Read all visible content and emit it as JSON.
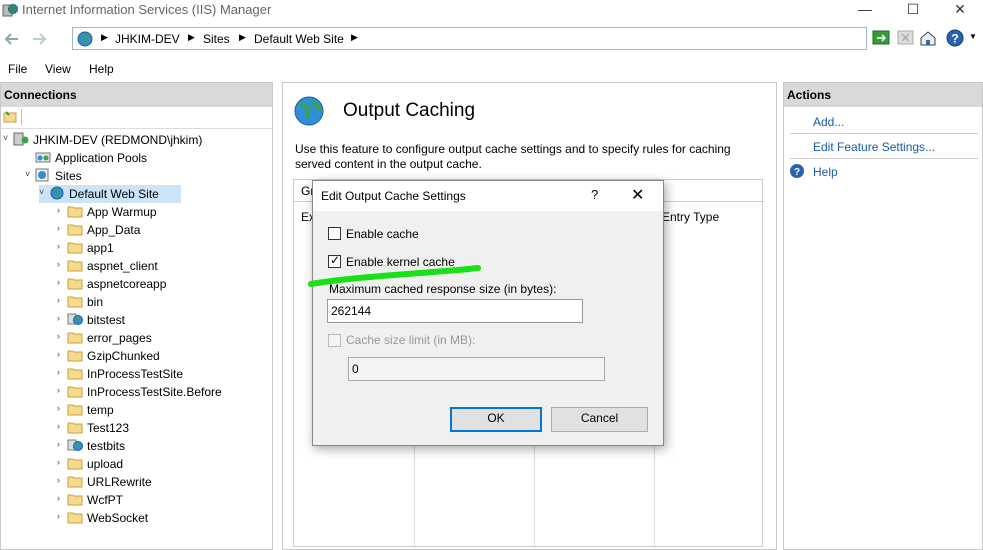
{
  "window": {
    "title": "Internet Information Services (IIS) Manager",
    "controls": {
      "minimize": "—",
      "maximize": "☐",
      "close": "✕"
    }
  },
  "address": {
    "crumbs": [
      "JHKIM-DEV",
      "Sites",
      "Default Web Site"
    ],
    "separator": "▶"
  },
  "menu": [
    "File",
    "View",
    "Help"
  ],
  "connections": {
    "header": "Connections",
    "tree": [
      {
        "label": "JHKIM-DEV (REDMOND\\jhkim)",
        "icon": "server-icon",
        "level": 0,
        "expander": "˅"
      },
      {
        "label": "Application Pools",
        "icon": "app-pools-icon",
        "level": 1,
        "expander": ""
      },
      {
        "label": "Sites",
        "icon": "sites-icon",
        "level": 1,
        "expander": "˅"
      },
      {
        "label": "Default Web Site",
        "icon": "globe-icon",
        "level": 2,
        "expander": "˅",
        "selected": true
      },
      {
        "label": "App Warmup",
        "icon": "folder-icon",
        "level": 3,
        "expander": "›"
      },
      {
        "label": "App_Data",
        "icon": "folder-icon",
        "level": 3,
        "expander": "›"
      },
      {
        "label": "app1",
        "icon": "folder-icon",
        "level": 3,
        "expander": "›"
      },
      {
        "label": "aspnet_client",
        "icon": "folder-icon",
        "level": 3,
        "expander": "›"
      },
      {
        "label": "aspnetcoreapp",
        "icon": "folder-icon",
        "level": 3,
        "expander": "›"
      },
      {
        "label": "bin",
        "icon": "folder-icon",
        "level": 3,
        "expander": "›"
      },
      {
        "label": "bitstest",
        "icon": "web-app-icon",
        "level": 3,
        "expander": "›"
      },
      {
        "label": "error_pages",
        "icon": "folder-icon",
        "level": 3,
        "expander": "›"
      },
      {
        "label": "GzipChunked",
        "icon": "folder-icon",
        "level": 3,
        "expander": "›"
      },
      {
        "label": "InProcessTestSite",
        "icon": "folder-icon",
        "level": 3,
        "expander": "›"
      },
      {
        "label": "InProcessTestSite.Before",
        "icon": "folder-icon",
        "level": 3,
        "expander": "›"
      },
      {
        "label": "temp",
        "icon": "folder-icon",
        "level": 3,
        "expander": "›"
      },
      {
        "label": "Test123",
        "icon": "folder-icon",
        "level": 3,
        "expander": "›"
      },
      {
        "label": "testbits",
        "icon": "web-app-icon",
        "level": 3,
        "expander": "›"
      },
      {
        "label": "upload",
        "icon": "folder-icon",
        "level": 3,
        "expander": "›"
      },
      {
        "label": "URLRewrite",
        "icon": "folder-icon",
        "level": 3,
        "expander": "›"
      },
      {
        "label": "WcfPT",
        "icon": "folder-icon",
        "level": 3,
        "expander": "›"
      },
      {
        "label": "WebSocket",
        "icon": "folder-icon",
        "level": 3,
        "expander": "›"
      }
    ]
  },
  "main": {
    "title": "Output Caching",
    "description": "Use this feature to configure output cache settings and to specify rules for caching served content in the output cache.",
    "grid_header_fragment": "Gr",
    "column_fragment": "Ext",
    "column_entry_type": "Entry Type"
  },
  "actions": {
    "header": "Actions",
    "items": [
      "Add...",
      "Edit Feature Settings...",
      "Help"
    ]
  },
  "dialog": {
    "title": "Edit Output Cache Settings",
    "help": "?",
    "close": "✕",
    "enable_cache": {
      "label": "Enable cache",
      "checked": false
    },
    "enable_kernel_cache": {
      "label": "Enable kernel cache",
      "checked": true
    },
    "max_response_size": {
      "label": "Maximum cached response size (in bytes):",
      "value": "262144"
    },
    "cache_size_limit": {
      "label": "Cache size limit (in MB):",
      "checked": false,
      "enabled": false,
      "value": "0"
    },
    "ok": "OK",
    "cancel": "Cancel"
  },
  "colors": {
    "highlighter": "#1adf1a",
    "link": "#1a5aa8",
    "panel_header": "#d9d9d9",
    "selected_row": "#cce4f7"
  }
}
